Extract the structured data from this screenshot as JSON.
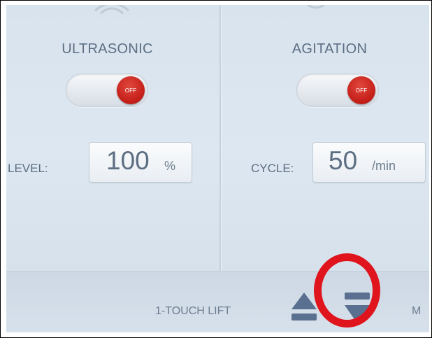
{
  "ultrasonic": {
    "title": "ULTRASONIC",
    "toggle_text": "OFF",
    "toggle_state": "off",
    "field_label": "LEVEL:",
    "value": "100",
    "unit": "%"
  },
  "agitation": {
    "title": "AGITATION",
    "toggle_text": "OFF",
    "toggle_state": "off",
    "field_label": "CYCLE:",
    "value": "50",
    "unit": "/min"
  },
  "bottom_bar": {
    "lift_label": "1-TOUCH LIFT",
    "cut_label": "M",
    "up_icon": "eject-up-icon",
    "down_icon": "lower-down-icon"
  },
  "colors": {
    "toggle_off_knob": "#c8221c",
    "highlight_ring": "#e0141c",
    "text": "#5c6e82",
    "icon": "#5a7090"
  }
}
